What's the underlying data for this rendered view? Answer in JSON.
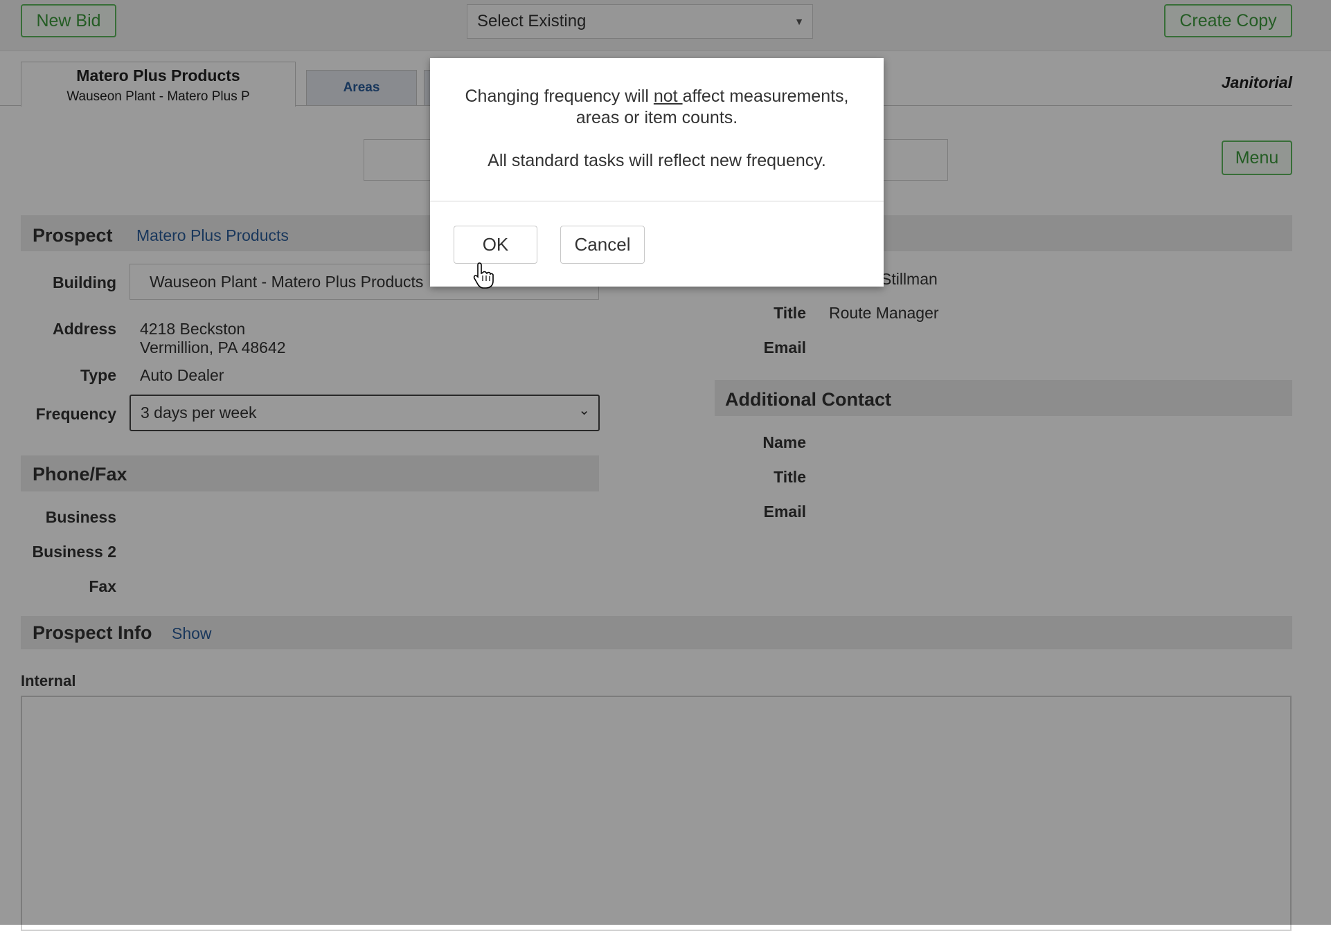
{
  "topbar": {
    "new_bid_label": "New Bid",
    "select_existing_value": "Select Existing",
    "create_copy_label": "Create Copy"
  },
  "tabs": {
    "active": {
      "title": "Matero Plus Products",
      "subtitle": "Wauseon Plant - Matero Plus P"
    },
    "areas_label": "Areas"
  },
  "service_type": "Janitorial",
  "menu_label": "Menu",
  "prospect": {
    "section_title": "Prospect",
    "name_link": "Matero Plus Products",
    "building_label": "Building",
    "building_value": "Wauseon Plant - Matero Plus Products",
    "address_label": "Address",
    "address_line1": "4218 Beckston",
    "address_line2": "Vermillion, PA 48642",
    "type_label": "Type",
    "type_value": "Auto Dealer",
    "frequency_label": "Frequency",
    "frequency_value": "3 days per week"
  },
  "contact": {
    "name_value_partial": "Stillman",
    "title_label": "Title",
    "title_value": "Route Manager",
    "email_label": "Email"
  },
  "additional_contact": {
    "section_title": "Additional Contact",
    "name_label": "Name",
    "title_label": "Title",
    "email_label": "Email"
  },
  "phone_fax": {
    "section_title": "Phone/Fax",
    "business_label": "Business",
    "business2_label": "Business 2",
    "fax_label": "Fax"
  },
  "prospect_info": {
    "section_title": "Prospect Info",
    "show_link": "Show",
    "internal_label": "Internal"
  },
  "modal": {
    "message_pre": "Changing frequency will ",
    "message_emphasis": "not ",
    "message_post": "affect measurements,",
    "message_line2": "areas or item counts.",
    "message_secondary": "All standard tasks will reflect new frequency.",
    "ok_label": "OK",
    "cancel_label": "Cancel"
  },
  "colors": {
    "accent_green": "#5cb85c",
    "link_blue": "#2a5d99",
    "section_bar": "#ececec"
  }
}
